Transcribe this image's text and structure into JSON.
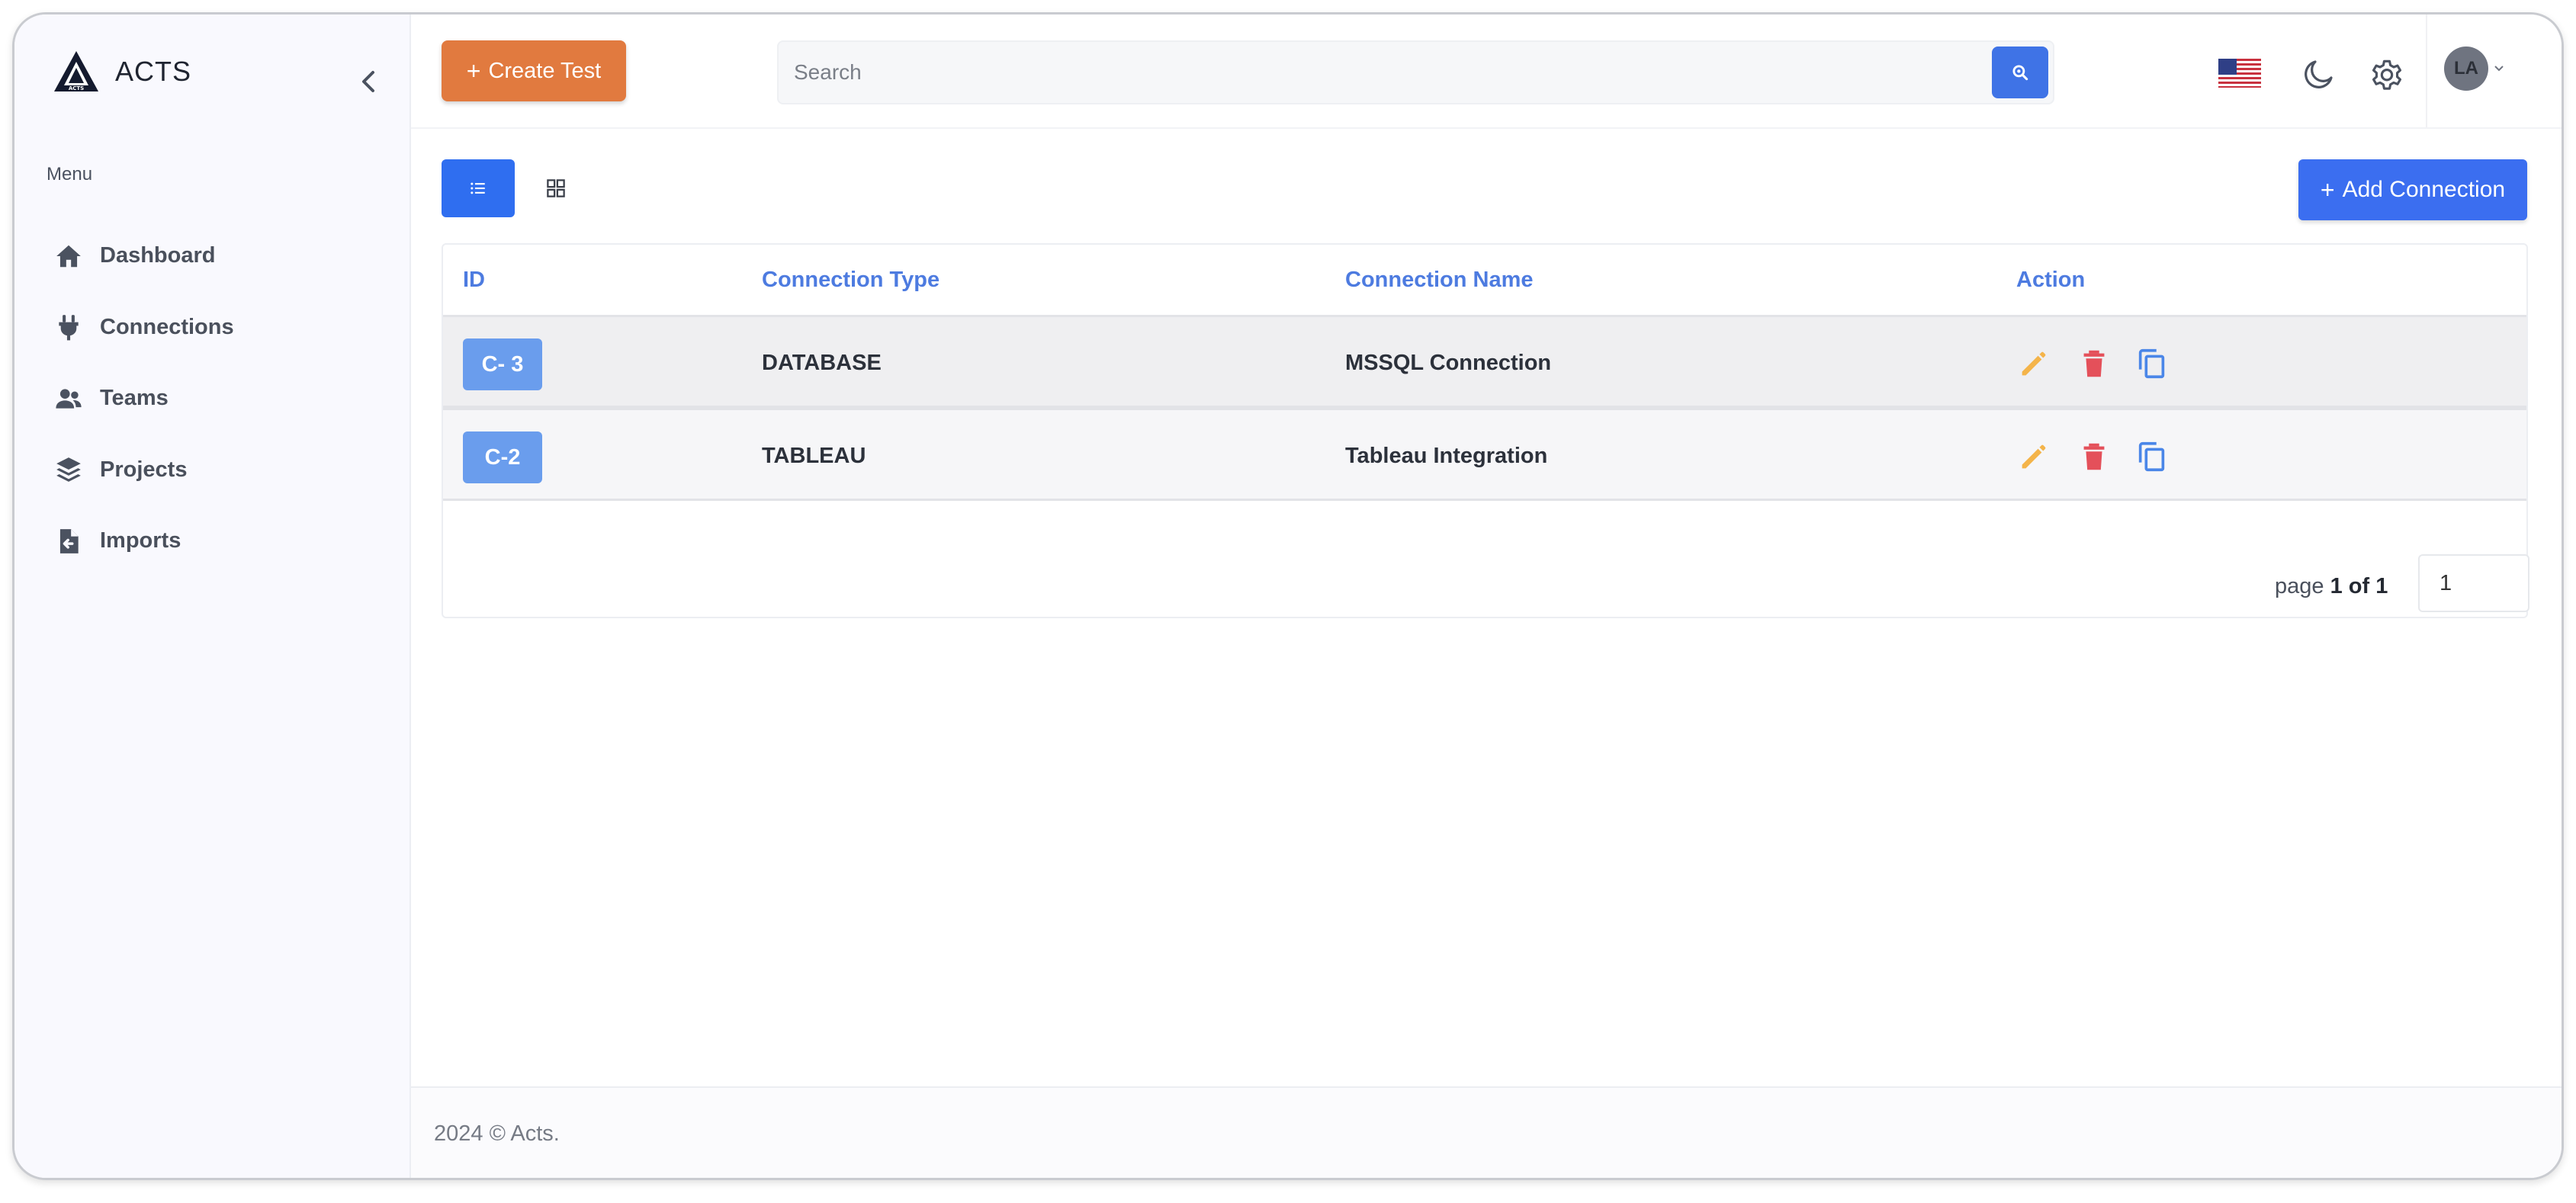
{
  "brand": {
    "name": "ACTS",
    "logo_text": "ACTS"
  },
  "sidebar": {
    "menu_title": "Menu",
    "items": [
      {
        "label": "Dashboard",
        "icon": "home-icon"
      },
      {
        "label": "Connections",
        "icon": "plug-icon"
      },
      {
        "label": "Teams",
        "icon": "users-icon"
      },
      {
        "label": "Projects",
        "icon": "layers-icon"
      },
      {
        "label": "Imports",
        "icon": "file-import-icon"
      }
    ]
  },
  "header": {
    "create_label": "Create Test",
    "search_placeholder": "Search",
    "language": "en-US",
    "avatar_initials": "LA"
  },
  "toolbar": {
    "add_label": "Add Connection"
  },
  "table": {
    "columns": [
      "ID",
      "Connection Type",
      "Connection Name",
      "Action"
    ],
    "rows": [
      {
        "id": "C- 3",
        "type": "DATABASE",
        "name": "MSSQL Connection"
      },
      {
        "id": "C-2",
        "type": "TABLEAU",
        "name": "Tableau Integration"
      }
    ]
  },
  "pagination": {
    "prefix": "page",
    "current": "1",
    "of": "of",
    "total": "1",
    "input_value": "1"
  },
  "footer": {
    "text": "2024 © Acts."
  },
  "colors": {
    "primary": "#2f6ef0",
    "create": "#e17a3f",
    "edit": "#f4b44a",
    "delete": "#e4505a",
    "copy": "#4a86e8",
    "badge": "#6a9ded",
    "header_text": "#4d7be0"
  }
}
